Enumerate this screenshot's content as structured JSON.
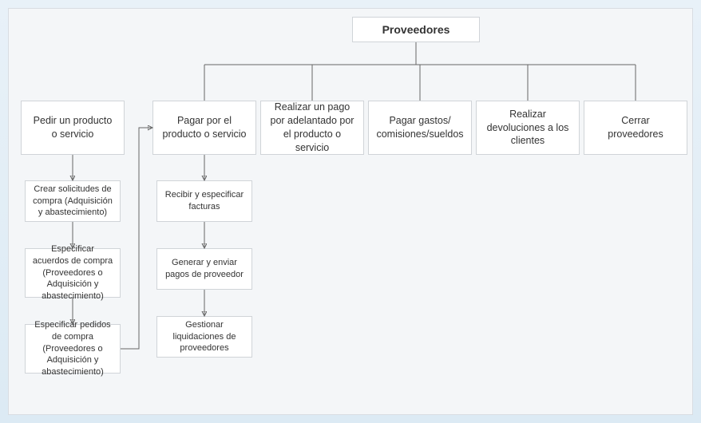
{
  "diagram": {
    "root": "Proveedores",
    "categories": [
      "Pedir un producto o servicio",
      "Pagar por el producto o servicio",
      "Realizar un pago por adelantado por el producto o servicio",
      "Pagar gastos/ comisiones/sueldos",
      "Realizar devoluciones a los clientes",
      "Cerrar proveedores"
    ],
    "col1_subs": [
      "Crear solicitudes de compra (Adquisición y abastecimiento)",
      "Especificar acuerdos de compra (Proveedores o Adquisición y abastecimiento)",
      "Especificar pedidos de compra (Proveedores o Adquisición y abastecimiento)"
    ],
    "col2_subs": [
      "Recibir y especificar facturas",
      "Generar y enviar pagos de proveedor",
      "Gestionar liquidaciones de proveedores"
    ]
  }
}
